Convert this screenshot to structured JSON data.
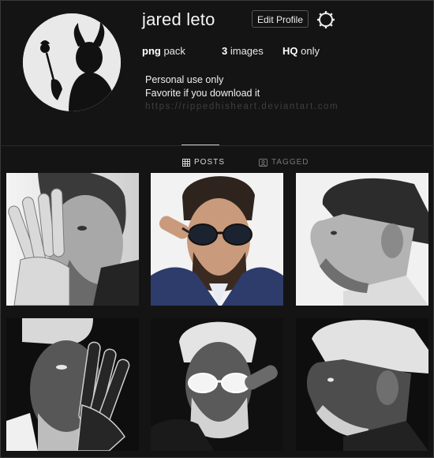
{
  "profile": {
    "username": "jared leto",
    "edit_label": "Edit Profile",
    "stats": [
      {
        "value": "png",
        "label": "pack"
      },
      {
        "value": "3",
        "label": "images"
      },
      {
        "value": "HQ",
        "label": "only"
      }
    ],
    "bio_lines": [
      "Personal use only",
      "Favorite if you download it"
    ],
    "link": "https://rippedhisheart.deviantart.com"
  },
  "tabs": [
    {
      "label": "POSTS",
      "icon": "grid-icon",
      "active": true
    },
    {
      "label": "TAGGED",
      "icon": "tag-icon",
      "active": false
    }
  ],
  "grid": {
    "posts": [
      {
        "subject": "hand-over-face",
        "style": "grayscale"
      },
      {
        "subject": "sunglasses-blue-jacket",
        "style": "color"
      },
      {
        "subject": "side-profile",
        "style": "grayscale"
      },
      {
        "subject": "hand-over-face",
        "style": "inverted"
      },
      {
        "subject": "sunglasses",
        "style": "inverted"
      },
      {
        "subject": "side-profile",
        "style": "inverted"
      }
    ]
  },
  "colors": {
    "background": "#141414",
    "text": "#f2f2f2",
    "muted": "#777777"
  }
}
